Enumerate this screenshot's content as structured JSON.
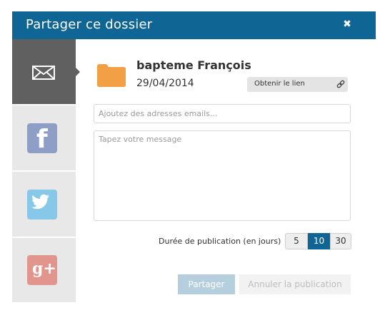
{
  "dialog": {
    "title": "Partager ce dossier",
    "close_glyph": "✖"
  },
  "sidebar": {
    "items": [
      {
        "name": "email",
        "icon": "envelope-icon",
        "active": true
      },
      {
        "name": "facebook",
        "icon": "facebook-icon",
        "glyph": "f"
      },
      {
        "name": "twitter",
        "icon": "twitter-bird-icon"
      },
      {
        "name": "google-plus",
        "icon": "google-plus-icon",
        "glyph": "g+"
      }
    ]
  },
  "folder": {
    "name": "bapteme François",
    "date": "29/04/2014",
    "icon": "folder-icon",
    "color": "#f29f45"
  },
  "link_button": {
    "label": "Obtenir le lien",
    "icon": "link-icon"
  },
  "email_field": {
    "placeholder": "Ajoutez des adresses emails...",
    "value": ""
  },
  "message_field": {
    "placeholder": "Tapez votre message",
    "value": ""
  },
  "duration": {
    "label": "Durée de publication (en jours)",
    "options": [
      "5",
      "10",
      "30"
    ],
    "selected": "10"
  },
  "actions": {
    "share_label": "Partager",
    "cancel_label": "Annuler la publication"
  },
  "colors": {
    "accent": "#0f6695",
    "sidebar_active": "#606060",
    "sidebar_inactive": "#e8e8e8",
    "facebook": "#8f9ec7",
    "twitter": "#87c8e8",
    "google_plus": "#e2958c"
  }
}
